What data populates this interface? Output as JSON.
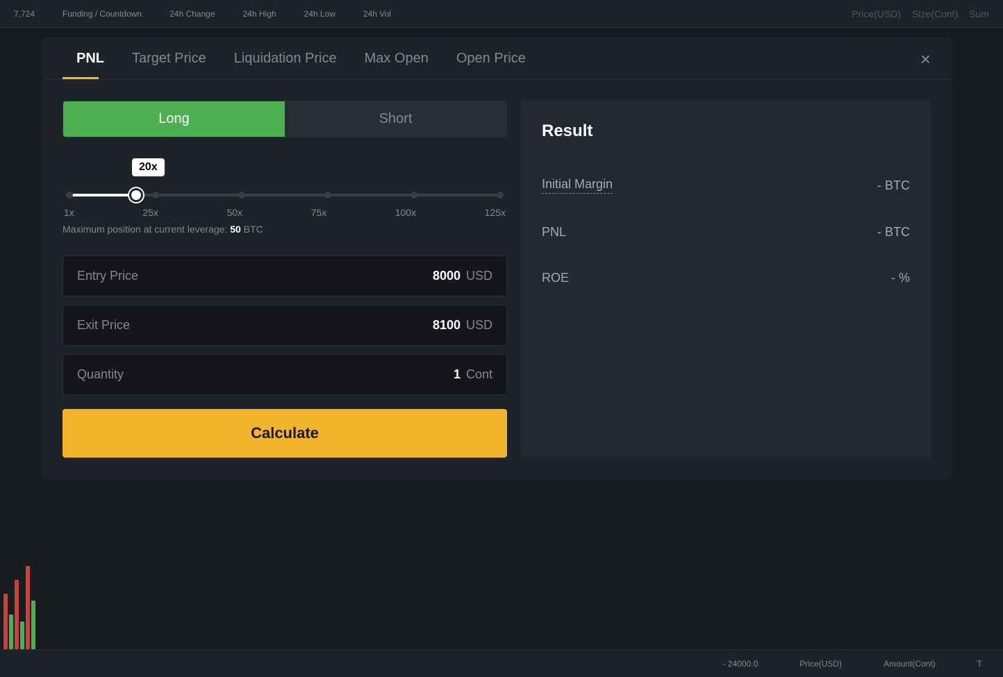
{
  "topBar": {
    "items": [
      {
        "label": "Funding / Countdown"
      },
      {
        "label": "24h Change"
      },
      {
        "label": "24h High"
      },
      {
        "label": "24h Low"
      },
      {
        "label": "24h Vol"
      }
    ]
  },
  "tabs": {
    "items": [
      {
        "label": "PNL",
        "active": true
      },
      {
        "label": "Target Price"
      },
      {
        "label": "Liquidation Price"
      },
      {
        "label": "Max Open"
      },
      {
        "label": "Open Price"
      }
    ],
    "closeLabel": "×"
  },
  "toggle": {
    "longLabel": "Long",
    "shortLabel": "Short"
  },
  "leverage": {
    "current": "20x",
    "labels": [
      "1x",
      "25x",
      "50x",
      "75x",
      "100x",
      "125x"
    ],
    "maxPositionText": "Maximum position at current leverage:",
    "maxPositionValue": "50",
    "maxPositionUnit": "BTC"
  },
  "inputs": [
    {
      "label": "Entry Price",
      "value": "8000",
      "unit": "USD"
    },
    {
      "label": "Exit Price",
      "value": "8100",
      "unit": "USD"
    },
    {
      "label": "Quantity",
      "value": "1",
      "unit": "Cont"
    }
  ],
  "calculateButton": {
    "label": "Calculate"
  },
  "result": {
    "title": "Result",
    "rows": [
      {
        "label": "Initial Margin",
        "underlined": true,
        "value": "- BTC"
      },
      {
        "label": "PNL",
        "underlined": false,
        "value": "- BTC"
      },
      {
        "label": "ROE",
        "underlined": false,
        "value": "- %"
      }
    ]
  },
  "bottomBar": {
    "items": [
      {
        "label": "- 24000.0"
      },
      {
        "label": "Price(USD)"
      },
      {
        "label": "Amount(Cont)"
      },
      {
        "label": "T"
      }
    ]
  },
  "priceLabel": "7,724",
  "columnHeaders": {
    "price": "Price(USD)",
    "size": "Size(Cont)",
    "sum": "Sum"
  }
}
